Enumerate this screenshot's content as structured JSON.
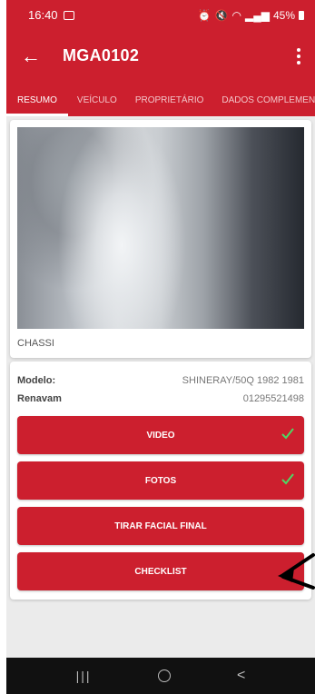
{
  "status_bar": {
    "time": "16:40",
    "battery": "45%"
  },
  "app_bar": {
    "title": "MGA0102"
  },
  "tabs": [
    {
      "label": "RESUMO",
      "active": true
    },
    {
      "label": "VEÍCULO",
      "active": false
    },
    {
      "label": "PROPRIETÁRIO",
      "active": false
    },
    {
      "label": "DADOS COMPLEMENTA",
      "active": false
    }
  ],
  "photo_card": {
    "label": "CHASSI"
  },
  "info": {
    "modelo_label": "Modelo:",
    "modelo_value": "SHINERAY/50Q 1982 1981",
    "renavam_label": "Renavam",
    "renavam_value": "01295521498"
  },
  "buttons": {
    "video": "VIDEO",
    "fotos": "FOTOS",
    "tirar_facial": "TIRAR FACIAL FINAL",
    "checklist": "CHECKLIST"
  },
  "colors": {
    "primary": "#cc1f2e",
    "check": "#4cd964"
  }
}
